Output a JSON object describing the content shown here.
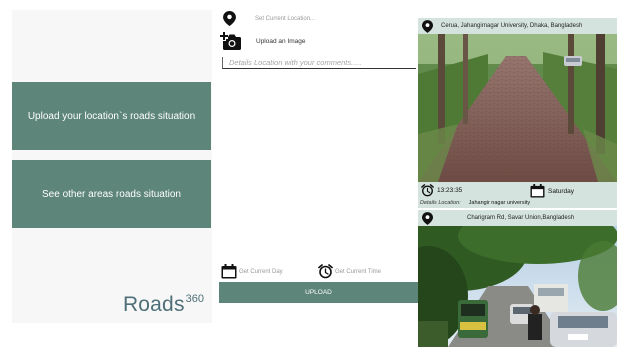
{
  "home": {
    "upload_button": "Upload your location`s roads situation",
    "see_button": "See other areas roads situation",
    "logo_word": "Roads",
    "logo_number": "360"
  },
  "upload_form": {
    "location_label": "Set Current Location...",
    "image_label": "Upload an Image",
    "comment_placeholder": "Details Location with your comments.....",
    "day_label": "Get Current Day",
    "time_label": "Get Current Time",
    "upload_button": "UPLOAD"
  },
  "feed": {
    "posts": [
      {
        "location": "Cerua, Jahangirnagar University, Dhaka, Bangladesh",
        "time": "13:23:35",
        "day": "Saturday",
        "details_label": "Details Location:",
        "details_value": "Jahangir nagar university"
      },
      {
        "location": "Charigram Rd, Savar Union,Bangladesh"
      }
    ]
  },
  "colors": {
    "accent": "#5d8579",
    "card_background": "#d4e3dd",
    "logo": "#4f6f78"
  },
  "icons": {
    "pin": "map-pin-icon",
    "camera": "camera-add-icon",
    "calendar": "calendar-icon",
    "clock": "alarm-clock-icon"
  }
}
